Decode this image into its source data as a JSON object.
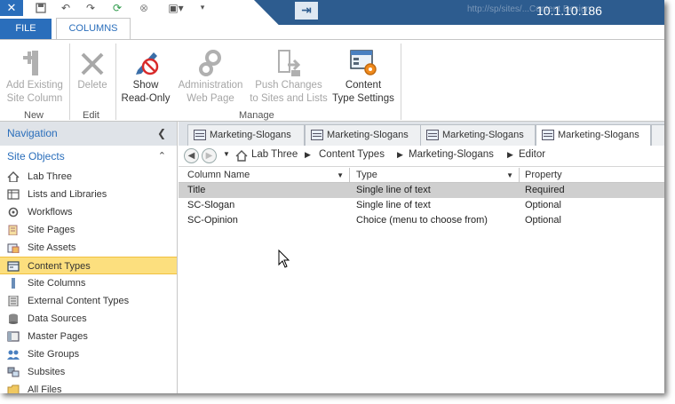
{
  "titlebar": {
    "url": "http://sp/sites/...Content Design",
    "ip": "10.1.10.186"
  },
  "tabs": {
    "file": "FILE",
    "columns": "COLUMNS"
  },
  "ribbon": {
    "buttons": [
      {
        "line1": "Add Existing",
        "line2": "Site Column",
        "icon": "add-column-icon",
        "enabled": false
      },
      {
        "line1": "Delete",
        "line2": "",
        "icon": "delete-x-icon",
        "enabled": false
      },
      {
        "line1": "Show",
        "line2": "Read-Only",
        "icon": "pencil-forbidden-icon",
        "enabled": true
      },
      {
        "line1": "Administration",
        "line2": "Web Page",
        "icon": "gears-icon",
        "enabled": false
      },
      {
        "line1": "Push Changes",
        "line2": "to Sites and Lists",
        "icon": "push-changes-icon",
        "enabled": false
      },
      {
        "line1": "Content",
        "line2": "Type Settings",
        "icon": "content-type-settings-icon",
        "enabled": true
      }
    ],
    "groups": {
      "new": "New",
      "edit": "Edit",
      "manage": "Manage"
    }
  },
  "navigation": {
    "header": "Navigation",
    "section": "Site Objects",
    "items": [
      {
        "label": "Lab Three",
        "icon": "home-icon"
      },
      {
        "label": "Lists and Libraries",
        "icon": "list-icon"
      },
      {
        "label": "Workflows",
        "icon": "workflow-icon"
      },
      {
        "label": "Site Pages",
        "icon": "pages-icon"
      },
      {
        "label": "Site Assets",
        "icon": "assets-icon"
      },
      {
        "label": "Content Types",
        "icon": "content-types-icon",
        "selected": true
      },
      {
        "label": "Site Columns",
        "icon": "site-columns-icon"
      },
      {
        "label": "External Content Types",
        "icon": "external-content-icon"
      },
      {
        "label": "Data Sources",
        "icon": "database-icon"
      },
      {
        "label": "Master Pages",
        "icon": "master-pages-icon"
      },
      {
        "label": "Site Groups",
        "icon": "groups-icon"
      },
      {
        "label": "Subsites",
        "icon": "subsites-icon"
      },
      {
        "label": "All Files",
        "icon": "folder-icon"
      }
    ]
  },
  "doc_tabs": [
    {
      "label": "Marketing-Slogans",
      "active": false
    },
    {
      "label": "Marketing-Slogans",
      "active": false
    },
    {
      "label": "Marketing-Slogans",
      "active": false
    },
    {
      "label": "Marketing-Slogans",
      "active": true
    }
  ],
  "breadcrumb": [
    "Lab Three",
    "Content Types",
    "Marketing-Slogans",
    "Editor"
  ],
  "grid": {
    "headers": [
      "Column Name",
      "Type",
      "Property"
    ],
    "rows": [
      {
        "name": "Title",
        "type": "Single line of text",
        "property": "Required",
        "selected": true
      },
      {
        "name": "SC-Slogan",
        "type": "Single line of text",
        "property": "Optional",
        "selected": false
      },
      {
        "name": "SC-Opinion",
        "type": "Choice (menu to choose from)",
        "property": "Optional",
        "selected": false
      }
    ]
  },
  "colors": {
    "accent": "#2a6ebb",
    "titlebar": "#2d5c8f",
    "selected_nav": "#fcdf7e"
  }
}
